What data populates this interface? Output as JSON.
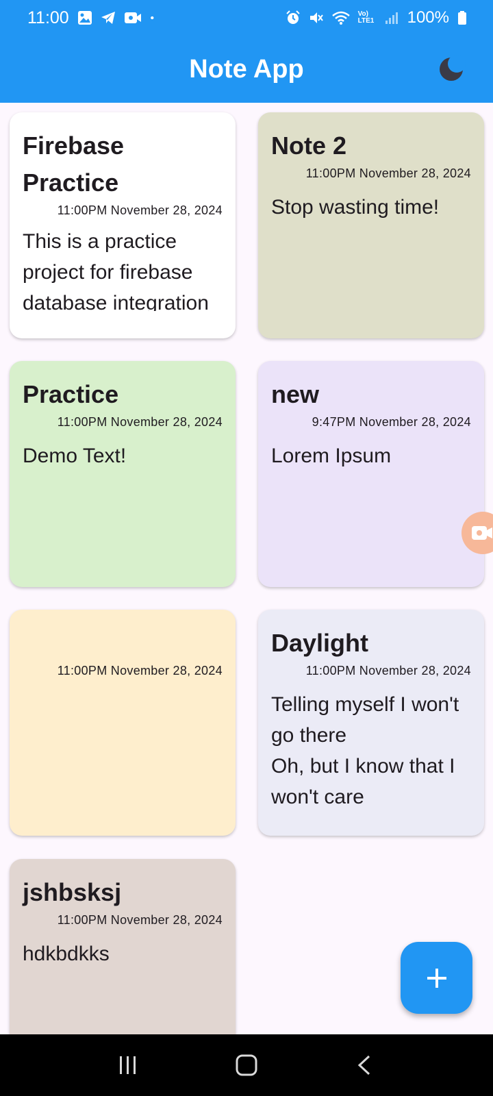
{
  "status_bar": {
    "time": "11:00",
    "battery_text": "100%",
    "network_label": "Vo) LTE1",
    "icons_left": [
      "gallery-icon",
      "telegram-icon",
      "video-icon",
      "dot-icon"
    ],
    "icons_right": [
      "alarm-icon",
      "mute-icon",
      "wifi-icon",
      "signal-icon",
      "battery-icon"
    ]
  },
  "app_bar": {
    "title": "Note App",
    "theme_icon": "moon-icon",
    "color": "#2196f3"
  },
  "notes": [
    {
      "title": "Firebase Practice",
      "date": "11:00PM November 28, 2024",
      "body": "This is a practice project for firebase database integration",
      "color": "#ffffff"
    },
    {
      "title": "Note 2",
      "date": "11:00PM November 28, 2024",
      "body": "Stop wasting time!",
      "color": "#dfdfc9"
    },
    {
      "title": "Practice",
      "date": "11:00PM November 28, 2024",
      "body": "Demo Text!",
      "color": "#d8f0cc"
    },
    {
      "title": "new",
      "date": "9:47PM November 28, 2024",
      "body": "Lorem Ipsum",
      "color": "#ebe3f9"
    },
    {
      "title": "",
      "date": "11:00PM November 28, 2024",
      "body": "",
      "color": "#feeecd"
    },
    {
      "title": "Daylight",
      "date": "11:00PM November 28, 2024",
      "body": "Telling myself I won't go there\nOh, but I know that I won't care\nTryna wash away",
      "color": "#ebebf6"
    },
    {
      "title": "jshbsksj",
      "date": "11:00PM November 28, 2024",
      "body": "hdkbdkks",
      "color": "#e1d6d1"
    }
  ],
  "fab": {
    "icon": "plus-icon"
  },
  "recorder_bubble": {
    "icon": "video-camera-icon",
    "color": "#f7b899"
  },
  "nav_bar": {
    "buttons": [
      "recent-apps-icon",
      "home-icon",
      "back-icon"
    ]
  }
}
